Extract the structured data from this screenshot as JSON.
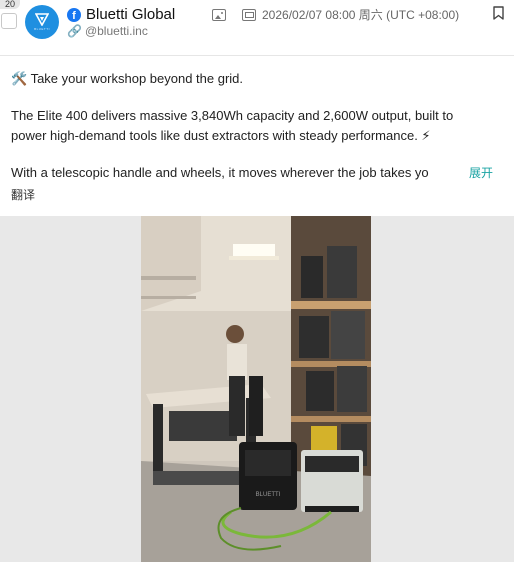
{
  "list": {
    "index_badge": "20"
  },
  "account": {
    "name": "Bluetti Global",
    "handle": "@bluetti.inc",
    "avatar_wordmark": "BLUETTI",
    "platform_icon": "facebook-icon",
    "brand_color": "#1f8fe0"
  },
  "post_meta": {
    "datetime": "2026/02/07 08:00 周六 (UTC +08:00)",
    "media_type_icon": "image-icon",
    "post_type_icon": "post-icon",
    "bookmark_icon": "bookmark-icon"
  },
  "post": {
    "line1": "🛠️ Take your workshop beyond the grid.",
    "line2a": "The Elite 400 delivers massive 3,840Wh capacity and 2,600W output, built to",
    "line2b": "power high-demand tools like dust extractors with steady performance. ⚡",
    "line3": "With a telescopic handle and wheels, it moves wherever the job takes yo",
    "expand_label": "展开",
    "translate_label": "翻译",
    "accent_color": "#1aa3a3"
  },
  "media": {
    "description_icon": "workshop-photo",
    "power_station_label": "BLUETTI"
  }
}
